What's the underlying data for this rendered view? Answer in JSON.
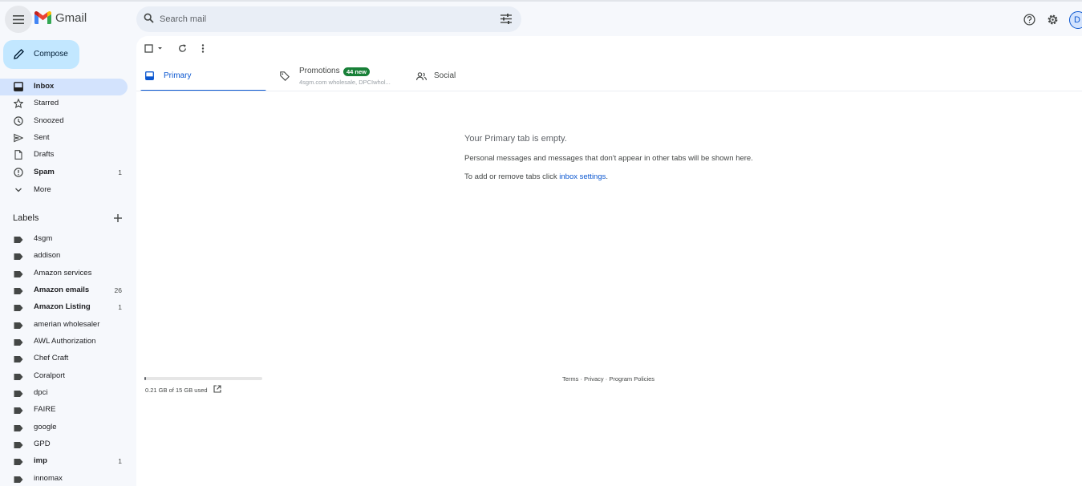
{
  "header": {
    "brand": "Gmail",
    "search_placeholder": "Search mail",
    "avatar_initial": "D"
  },
  "compose_label": "Compose",
  "nav": [
    {
      "label": "Inbox",
      "count": "",
      "icon": "inbox-icon",
      "active": true,
      "bold": true
    },
    {
      "label": "Starred",
      "count": "",
      "icon": "star-icon",
      "active": false,
      "bold": false
    },
    {
      "label": "Snoozed",
      "count": "",
      "icon": "clock-icon",
      "active": false,
      "bold": false
    },
    {
      "label": "Sent",
      "count": "",
      "icon": "send-icon",
      "active": false,
      "bold": false
    },
    {
      "label": "Drafts",
      "count": "",
      "icon": "draft-icon",
      "active": false,
      "bold": false
    },
    {
      "label": "Spam",
      "count": "1",
      "icon": "spam-icon",
      "active": false,
      "bold": true
    },
    {
      "label": "More",
      "count": "",
      "icon": "chevron-down-icon",
      "active": false,
      "bold": false
    }
  ],
  "labels_heading": "Labels",
  "labels": [
    {
      "label": "4sgm",
      "count": "",
      "bold": false
    },
    {
      "label": "addison",
      "count": "",
      "bold": false
    },
    {
      "label": "Amazon services",
      "count": "",
      "bold": false
    },
    {
      "label": "Amazon emails",
      "count": "26",
      "bold": true
    },
    {
      "label": "Amazon Listing",
      "count": "1",
      "bold": true
    },
    {
      "label": "amerian wholesaler",
      "count": "",
      "bold": false
    },
    {
      "label": "AWL Authorization",
      "count": "",
      "bold": false
    },
    {
      "label": "Chef Craft",
      "count": "",
      "bold": false
    },
    {
      "label": "Coralport",
      "count": "",
      "bold": false
    },
    {
      "label": "dpci",
      "count": "",
      "bold": false
    },
    {
      "label": "FAIRE",
      "count": "",
      "bold": false
    },
    {
      "label": "google",
      "count": "",
      "bold": false
    },
    {
      "label": "GPD",
      "count": "",
      "bold": false
    },
    {
      "label": "imp",
      "count": "1",
      "bold": true
    },
    {
      "label": "innomax",
      "count": "",
      "bold": false
    }
  ],
  "tabs": {
    "primary": {
      "label": "Primary"
    },
    "promotions": {
      "label": "Promotions",
      "badge": "44 new",
      "sub": "4sgm.com wholesale, DPCIwhol..."
    },
    "social": {
      "label": "Social"
    }
  },
  "empty": {
    "title": "Your Primary tab is empty.",
    "desc": "Personal messages and messages that don't appear in other tabs will be shown here.",
    "hint_prefix": "To add or remove tabs click ",
    "hint_link": "inbox settings",
    "hint_suffix": "."
  },
  "storage": {
    "text": "0.21 GB of 15 GB used",
    "used_fraction": 0.014
  },
  "footer": {
    "terms": "Terms",
    "privacy": "Privacy",
    "policies": "Program Policies",
    "sep": " · "
  },
  "colors": {
    "accent": "#0b57d0",
    "compose_bg": "#c2e7ff",
    "active_bg": "#d3e3fd",
    "badge_green": "#188038"
  }
}
